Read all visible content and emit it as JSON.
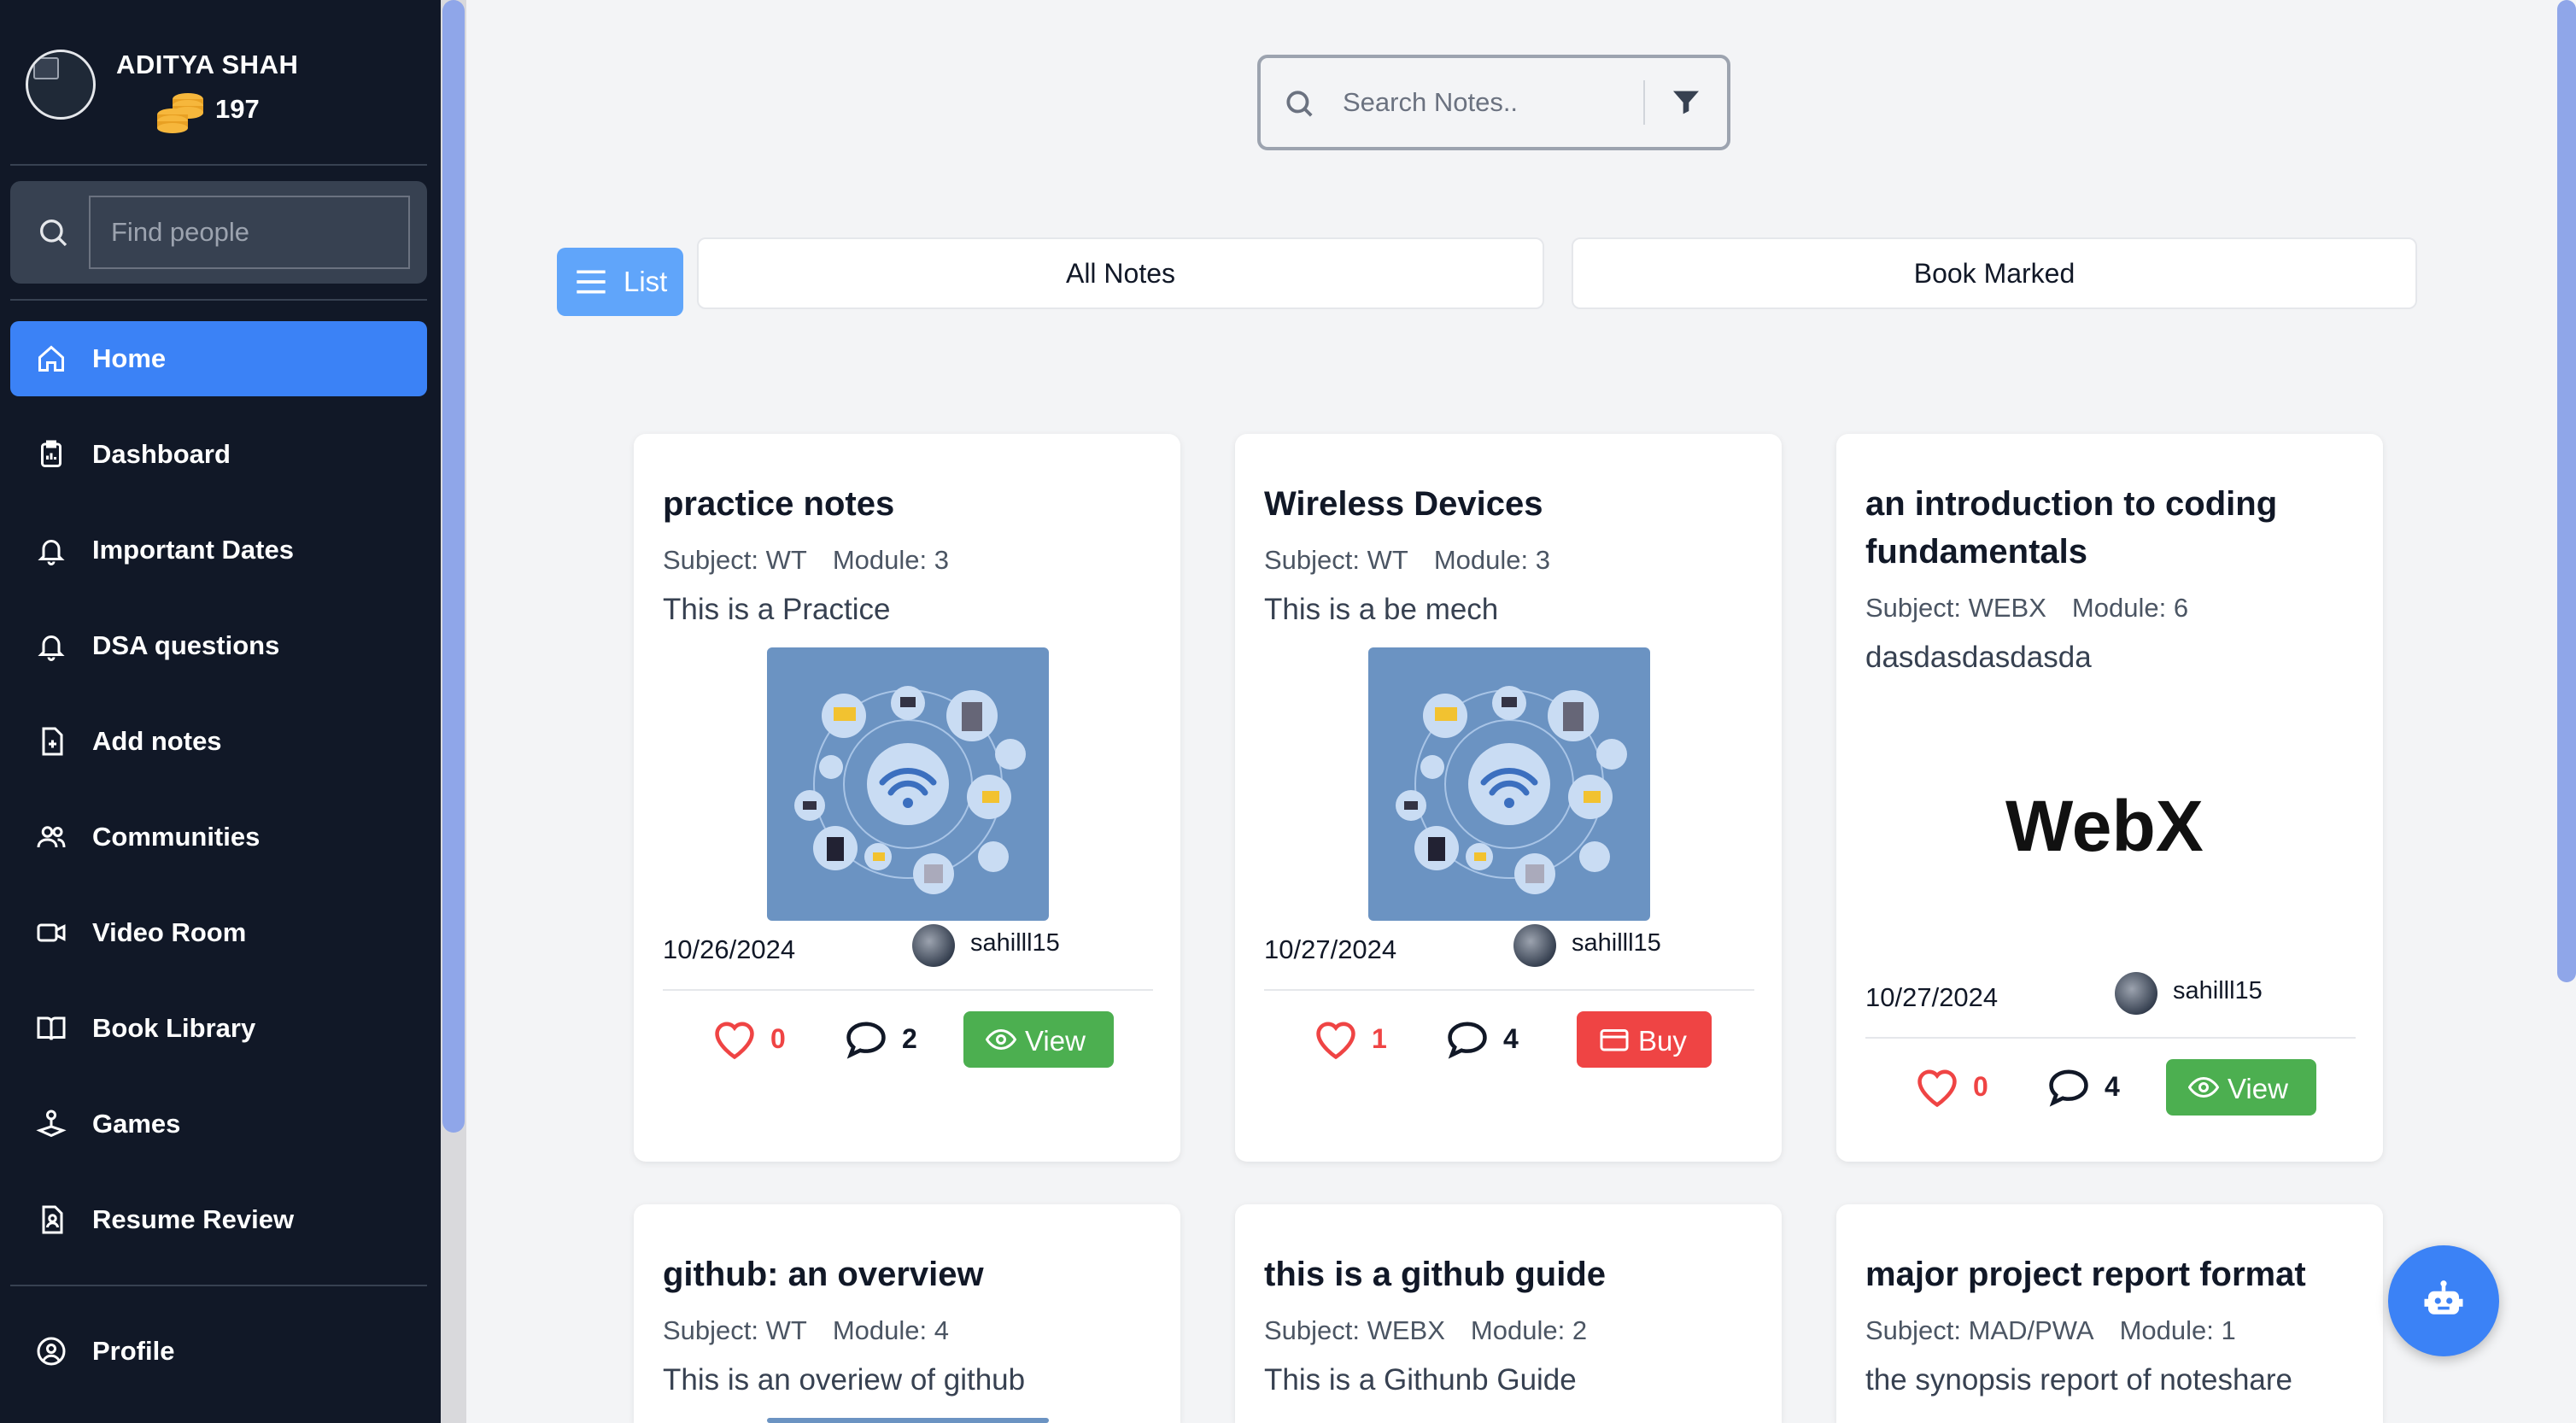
{
  "user": {
    "name": "ADITYA SHAH",
    "coins": "197"
  },
  "sidebar": {
    "find_placeholder": "Find people",
    "items": [
      {
        "label": "Home",
        "icon": "home-icon",
        "active": true
      },
      {
        "label": "Dashboard",
        "icon": "clipboard-icon"
      },
      {
        "label": "Important Dates",
        "icon": "bell-icon"
      },
      {
        "label": "DSA questions",
        "icon": "bell-icon"
      },
      {
        "label": "Add notes",
        "icon": "file-plus-icon"
      },
      {
        "label": "Communities",
        "icon": "users-icon"
      },
      {
        "label": "Video Room",
        "icon": "video-icon"
      },
      {
        "label": "Book Library",
        "icon": "book-icon"
      },
      {
        "label": "Games",
        "icon": "joystick-icon"
      },
      {
        "label": "Resume Review",
        "icon": "resume-icon"
      }
    ],
    "profile_label": "Profile"
  },
  "search": {
    "placeholder": "Search Notes.."
  },
  "tabs": {
    "list_label": "List",
    "all_notes": "All Notes",
    "bookmarked": "Book Marked"
  },
  "cards": [
    {
      "title": "practice notes",
      "subject": "Subject: WT",
      "module": "Module: 3",
      "description": "This is a Practice",
      "thumbnail": "wireless-network-illustration",
      "date": "10/26/2024",
      "author": "sahilll15",
      "likes": "0",
      "comments": "2",
      "action": "View"
    },
    {
      "title": "Wireless Devices",
      "subject": "Subject: WT",
      "module": "Module: 3",
      "description": "This is a be mech",
      "thumbnail": "wireless-network-illustration",
      "date": "10/27/2024",
      "author": "sahilll15",
      "likes": "1",
      "comments": "4",
      "action": "Buy"
    },
    {
      "title": "an introduction to coding fundamentals",
      "subject": "Subject: WEBX",
      "module": "Module: 6",
      "description": "dasdasdasdasda",
      "thumbnail": "webx-logo",
      "thumbnail_text": "WebX",
      "date": "10/27/2024",
      "author": "sahilll15",
      "likes": "0",
      "comments": "4",
      "action": "View"
    },
    {
      "title": "github: an overview",
      "subject": "Subject: WT",
      "module": "Module: 4",
      "description": "This is an overiew of github"
    },
    {
      "title": "this is a github guide",
      "subject": "Subject: WEBX",
      "module": "Module: 2",
      "description": "This is a Githunb Guide"
    },
    {
      "title": "major project report format",
      "subject": "Subject: MAD/PWA",
      "module": "Module: 1",
      "description": "the synopsis report of noteshare"
    }
  ],
  "colors": {
    "sidebar_bg": "#111827",
    "active": "#3b82f6",
    "view": "#4caf50",
    "buy": "#ef4444",
    "like": "#ef4444"
  }
}
